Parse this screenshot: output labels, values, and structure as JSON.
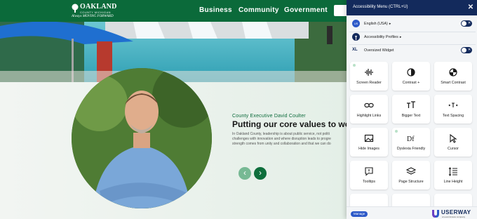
{
  "header": {
    "logo_main": "OAKLAND",
    "logo_sub": "COUNTY MICHIGAN",
    "logo_tagline": "Always MOVING FORWARD",
    "nav": [
      "Business",
      "Community",
      "Government"
    ]
  },
  "feature": {
    "kicker": "County Executive David Coulter",
    "headline": "Putting our core values to work",
    "body": [
      "In Oakland County, leadership is about public service, not politi",
      "challenges with innovation and where disruption leads to progre",
      "strength comes from unity and collaboration and that we can do"
    ],
    "prev_arrow": "‹",
    "next_arrow": "›"
  },
  "accessibility_panel": {
    "title": "Accessibility Menu (CTRL+U)",
    "close": "✕",
    "language": {
      "label": "English (USA)",
      "icon_text": "US",
      "caret": "▸"
    },
    "profiles": {
      "label": "Accessibility Profiles",
      "caret": "▸"
    },
    "widget": {
      "label": "Oversized Widget",
      "icon_text": "XL"
    },
    "tiles": [
      {
        "label": "Screen Reader",
        "icon": "screen-reader-icon",
        "dot": true
      },
      {
        "label": "Contrast +",
        "icon": "contrast-icon",
        "dot": false
      },
      {
        "label": "Smart Contrast",
        "icon": "smart-contrast-icon",
        "dot": false
      },
      {
        "label": "Highlight Links",
        "icon": "link-icon",
        "dot": false
      },
      {
        "label": "Bigger Text",
        "icon": "text-size-icon",
        "dot": false
      },
      {
        "label": "Text Spacing",
        "icon": "text-spacing-icon",
        "dot": false
      },
      {
        "label": "Hide Images",
        "icon": "image-icon",
        "dot": false
      },
      {
        "label": "Dyslexia Friendly",
        "icon": "dyslexia-icon",
        "dot": true
      },
      {
        "label": "Cursor",
        "icon": "cursor-icon",
        "dot": false
      },
      {
        "label": "Tooltips",
        "icon": "tooltip-icon",
        "dot": false
      },
      {
        "label": "Page Structure",
        "icon": "layers-icon",
        "dot": false
      },
      {
        "label": "Line Height",
        "icon": "line-height-icon",
        "dot": false
      }
    ],
    "footer": {
      "manage": "Manage",
      "brand": "USERWAY",
      "brand_sub": "a Level Access company"
    }
  },
  "colors": {
    "header_green": "#0b6a3a",
    "panel_navy": "#132a5c",
    "accent_blue": "#2c59c8",
    "mint": "#77b994"
  }
}
